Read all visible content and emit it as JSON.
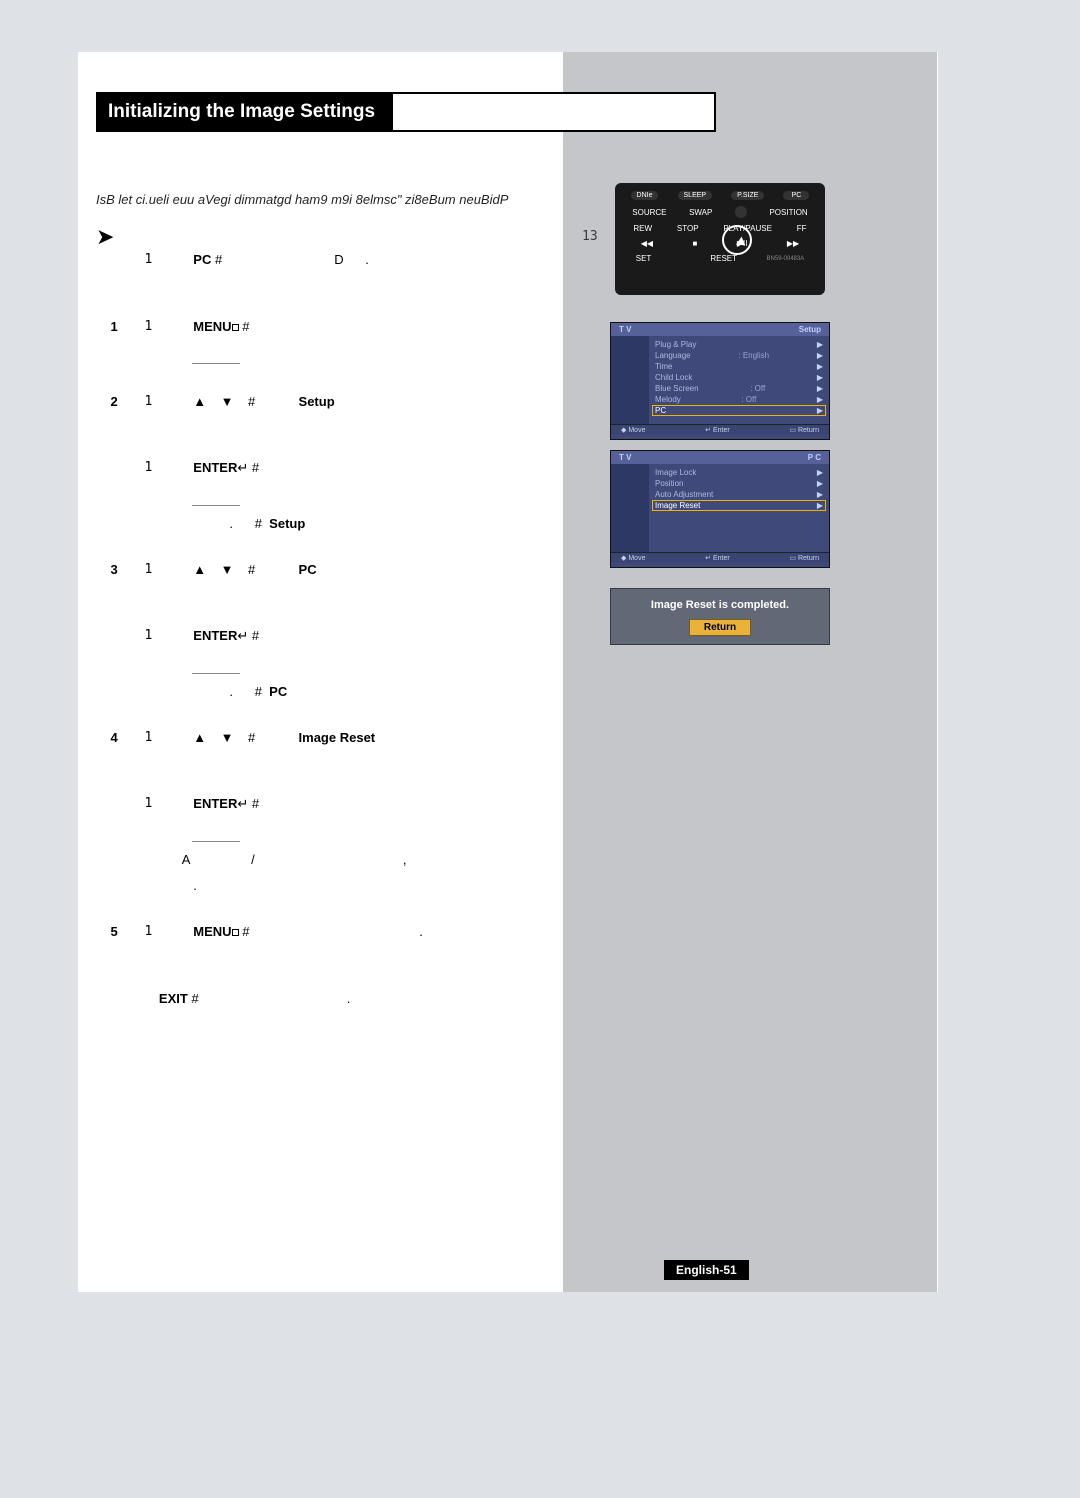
{
  "title": "Initializing the Image Settings",
  "intro": "IsB let ci.ueli euu aVegi dimmatgd ham9 m9i 8elmsc\" zi8eBum neuBidP",
  "step13": "13",
  "steps": {
    "s0a": "1",
    "s0_pc": "PC",
    "s0_d": "D",
    "s1n": "1",
    "s1a": "1",
    "s1_menu": "MENU",
    "s2n": "2",
    "s2a": "1",
    "s2b": "1",
    "s2_enter": "ENTER",
    "s2_setup": "Setup",
    "s2_setup2": "Setup",
    "s3n": "3",
    "s3a": "1",
    "s3b": "1",
    "s3_enter": "ENTER",
    "s3_pc": "PC",
    "s3_pc2": "PC",
    "s4n": "4",
    "s4a": "1",
    "s4b": "1",
    "s4_enter": "ENTER",
    "s4_ir": "Image Reset",
    "s4_A": "A",
    "s5n": "5",
    "s5a": "1",
    "s5_menu": "MENU",
    "s5_exit": "EXIT"
  },
  "remote": {
    "r1": [
      "DNIe",
      "SLEEP",
      "P.SIZE",
      "PC"
    ],
    "r2": [
      "SOURCE",
      "SWAP",
      "",
      "POSITION"
    ],
    "r3": [
      "REW",
      "STOP",
      "PLAY/PAUSE",
      "FF"
    ],
    "r4": [
      "SET",
      "",
      "RESET",
      ""
    ],
    "model": "BN59-00483A"
  },
  "osd1": {
    "left": "T V",
    "right": "Setup",
    "items": [
      {
        "l": "Plug & Play",
        "v": ""
      },
      {
        "l": "Language",
        "v": ": English"
      },
      {
        "l": "Time",
        "v": ""
      },
      {
        "l": "Child Lock",
        "v": ""
      },
      {
        "l": "Blue Screen",
        "v": ": Off"
      },
      {
        "l": "Melody",
        "v": ": Off"
      },
      {
        "l": "PC",
        "v": "",
        "sel": true
      }
    ],
    "foot": [
      "Move",
      "Enter",
      "Return"
    ]
  },
  "osd2": {
    "left": "T V",
    "right": "P C",
    "items": [
      {
        "l": "Image Lock",
        "v": ""
      },
      {
        "l": "Position",
        "v": ""
      },
      {
        "l": "Auto Adjustment",
        "v": ""
      },
      {
        "l": "Image Reset",
        "v": "",
        "sel": true
      }
    ],
    "foot": [
      "Move",
      "Enter",
      "Return"
    ]
  },
  "popup": {
    "msg": "Image Reset is completed.",
    "btn": "Return"
  },
  "pagenum": "English-51",
  "sym": {
    "hash": "#",
    "dot": ".",
    "comma": ",",
    "slash": "/",
    "up": "▲",
    "down": "▼",
    "arrow": "➤",
    "rew": "◀◀",
    "stop": "■",
    "play": "▶II",
    "ff": "▶▶",
    "tri": "▶",
    "updown": "◆"
  }
}
